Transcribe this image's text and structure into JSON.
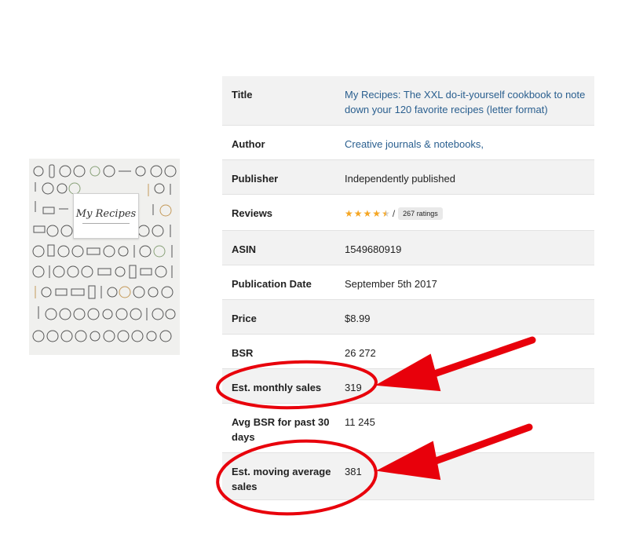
{
  "cover": {
    "title": "My Recipes"
  },
  "rows": [
    {
      "key": "Title",
      "value": "My Recipes: The XXL do-it-yourself cookbook to note down your 120 favorite recipes (letter format)"
    },
    {
      "key": "Author",
      "value": "Creative journals & notebooks,"
    },
    {
      "key": "Publisher",
      "value": "Independently published"
    },
    {
      "key": "Reviews",
      "rating": 4.5,
      "slash": "/",
      "ratings_label": "267 ratings"
    },
    {
      "key": "ASIN",
      "value": "1549680919"
    },
    {
      "key": "Publication Date",
      "value": "September 5th 2017"
    },
    {
      "key": "Price",
      "value": "$8.99"
    },
    {
      "key": "BSR",
      "value": "26 272"
    },
    {
      "key": "Est. monthly sales",
      "value": "319"
    },
    {
      "key": "Avg BSR for past 30 days",
      "value": "11 245"
    },
    {
      "key": "Est. moving average sales",
      "value": "381"
    }
  ],
  "colors": {
    "accent_red": "#e8000b",
    "link_blue": "#2a5f8f",
    "star": "#f5a623",
    "row_alt": "#f2f2f2"
  },
  "icons": [
    "star-icon",
    "half-star-icon",
    "annotation-ellipse",
    "annotation-arrow"
  ]
}
